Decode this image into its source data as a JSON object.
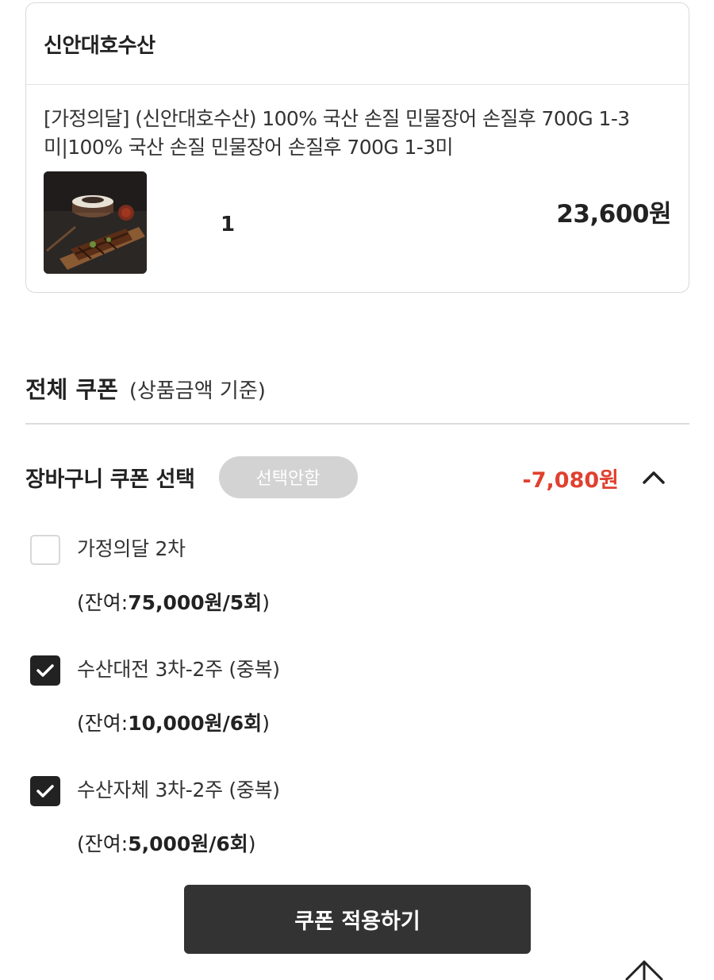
{
  "order": {
    "seller": "신안대호수산",
    "product_name": "[가정의달] (신안대호수산) 100% 국산 손질 민물장어 손질후 700G 1-3미|100% 국산 손질 민물장어 손질후 700G 1-3미",
    "quantity": "1",
    "price": "23,600원"
  },
  "coupons": {
    "title": "전체 쿠폰",
    "subtitle": "(상품금액 기준)",
    "cart_coupon_label": "장바구니 쿠폰 선택",
    "deselect_label": "선택안함",
    "discount": "-7,080원",
    "items": [
      {
        "name": "가정의달 2차",
        "remain_prefix": "(잔여:",
        "remain_value": "75,000원/5회",
        "remain_suffix": ")",
        "checked": false
      },
      {
        "name": "수산대전 3차-2주 (중복)",
        "remain_prefix": "(잔여:",
        "remain_value": "10,000원/6회",
        "remain_suffix": ")",
        "checked": true
      },
      {
        "name": "수산자체 3차-2주 (중복)",
        "remain_prefix": "(잔여:",
        "remain_value": "5,000원/6회",
        "remain_suffix": ")",
        "checked": true
      }
    ],
    "apply_label": "쿠폰 적용하기"
  },
  "icons": {
    "collapse": "chevron-up-icon",
    "scroll_top": "arrow-up-icon",
    "check": "checkmark-icon"
  },
  "colors": {
    "discount": "#e0412f",
    "button_dark": "#333333",
    "deselect_pill": "#d3d3d3"
  }
}
